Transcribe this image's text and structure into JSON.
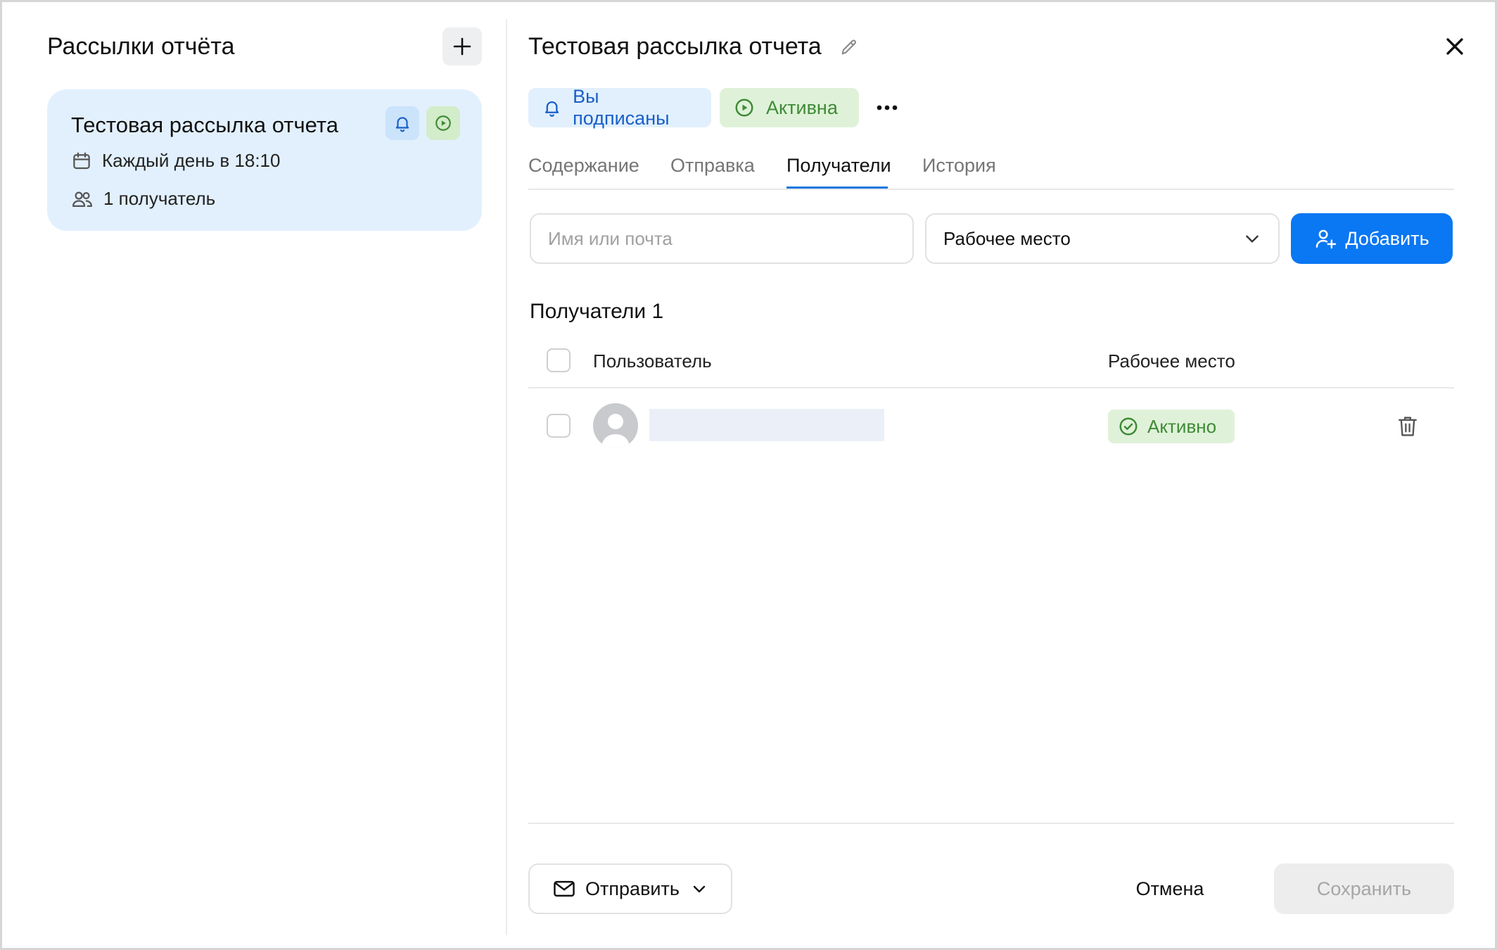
{
  "sidebar": {
    "title": "Рассылки отчёта",
    "card": {
      "title": "Тестовая рассылка отчета",
      "schedule": "Каждый день в 18:10",
      "recipients": "1 получатель"
    }
  },
  "header": {
    "title": "Тестовая рассылка отчета"
  },
  "chips": {
    "subscribed": "Вы подписаны",
    "active": "Активна"
  },
  "tabs": [
    {
      "label": "Содержание"
    },
    {
      "label": "Отправка"
    },
    {
      "label": "Получатели"
    },
    {
      "label": "История"
    }
  ],
  "active_tab": "Получатели",
  "toolbar": {
    "search_placeholder": "Имя или почта",
    "workspace_select": "Рабочее место",
    "add_label": "Добавить"
  },
  "recipients": {
    "title": "Получатели 1",
    "columns": {
      "user": "Пользователь",
      "workspace": "Рабочее место"
    },
    "rows": [
      {
        "status": "Активно"
      }
    ]
  },
  "footer": {
    "send_label": "Отправить",
    "cancel_label": "Отмена",
    "save_label": "Сохранить"
  },
  "colors": {
    "accent": "#0a77f3",
    "active_green": "#3f8a36",
    "card_bg": "#e2f0fd"
  }
}
